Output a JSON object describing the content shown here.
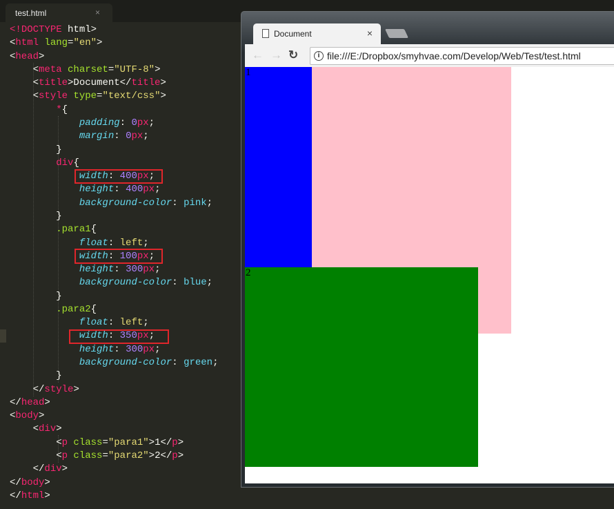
{
  "editor": {
    "tab_title": "test.html",
    "close_glyph": "×",
    "lines": [
      [
        [
          "tag",
          "<!"
        ],
        [
          "tag",
          "DOCTYPE"
        ],
        [
          "val",
          " html>"
        ]
      ],
      [
        [
          "val",
          "<"
        ],
        [
          "tag",
          "html"
        ],
        [
          "attr",
          " lang"
        ],
        [
          "val",
          "="
        ],
        [
          "str",
          "\"en\""
        ],
        [
          "val",
          ">"
        ]
      ],
      [
        [
          "val",
          "<"
        ],
        [
          "tag",
          "head"
        ],
        [
          "val",
          ">"
        ]
      ],
      [
        [
          "val",
          "    <"
        ],
        [
          "tag",
          "meta"
        ],
        [
          "attr",
          " charset"
        ],
        [
          "val",
          "="
        ],
        [
          "str",
          "\"UTF-8\""
        ],
        [
          "val",
          ">"
        ]
      ],
      [
        [
          "val",
          "    <"
        ],
        [
          "tag",
          "title"
        ],
        [
          "val",
          ">Document</"
        ],
        [
          "tag",
          "title"
        ],
        [
          "val",
          ">"
        ]
      ],
      [
        [
          "val",
          "    <"
        ],
        [
          "tag",
          "style"
        ],
        [
          "attr",
          " type"
        ],
        [
          "val",
          "="
        ],
        [
          "str",
          "\"text/css\""
        ],
        [
          "val",
          ">"
        ]
      ],
      [
        [
          "val",
          "        "
        ],
        [
          "tag",
          "*"
        ],
        [
          "val",
          "{"
        ]
      ],
      [
        [
          "val",
          "            "
        ],
        [
          "prop",
          "padding"
        ],
        [
          "val",
          ": "
        ],
        [
          "num",
          "0"
        ],
        [
          "unit",
          "px"
        ],
        [
          "val",
          ";"
        ]
      ],
      [
        [
          "val",
          "            "
        ],
        [
          "prop",
          "margin"
        ],
        [
          "val",
          ": "
        ],
        [
          "num",
          "0"
        ],
        [
          "unit",
          "px"
        ],
        [
          "val",
          ";"
        ]
      ],
      [
        [
          "val",
          "        }"
        ]
      ],
      [
        [
          "val",
          "        "
        ],
        [
          "tag",
          "div"
        ],
        [
          "val",
          "{"
        ]
      ],
      [
        [
          "val",
          "            "
        ],
        [
          "prop",
          "width"
        ],
        [
          "val",
          ": "
        ],
        [
          "num",
          "400"
        ],
        [
          "unit",
          "px"
        ],
        [
          "val",
          ";"
        ]
      ],
      [
        [
          "val",
          "            "
        ],
        [
          "prop",
          "height"
        ],
        [
          "val",
          ": "
        ],
        [
          "num",
          "400"
        ],
        [
          "unit",
          "px"
        ],
        [
          "val",
          ";"
        ]
      ],
      [
        [
          "val",
          "            "
        ],
        [
          "prop",
          "background-color"
        ],
        [
          "val",
          ": "
        ],
        [
          "kw",
          "pink"
        ],
        [
          "val",
          ";"
        ]
      ],
      [
        [
          "val",
          "        }"
        ]
      ],
      [
        [
          "val",
          "        "
        ],
        [
          "sel",
          ".para1"
        ],
        [
          "val",
          "{"
        ]
      ],
      [
        [
          "val",
          "            "
        ],
        [
          "prop",
          "float"
        ],
        [
          "val",
          ": "
        ],
        [
          "str",
          "left"
        ],
        [
          "val",
          ";"
        ]
      ],
      [
        [
          "val",
          "            "
        ],
        [
          "prop",
          "width"
        ],
        [
          "val",
          ": "
        ],
        [
          "num",
          "100"
        ],
        [
          "unit",
          "px"
        ],
        [
          "val",
          ";"
        ]
      ],
      [
        [
          "val",
          "            "
        ],
        [
          "prop",
          "height"
        ],
        [
          "val",
          ": "
        ],
        [
          "num",
          "300"
        ],
        [
          "unit",
          "px"
        ],
        [
          "val",
          ";"
        ]
      ],
      [
        [
          "val",
          "            "
        ],
        [
          "prop",
          "background-color"
        ],
        [
          "val",
          ": "
        ],
        [
          "kw",
          "blue"
        ],
        [
          "val",
          ";"
        ]
      ],
      [
        [
          "val",
          "        }"
        ]
      ],
      [
        [
          "val",
          "        "
        ],
        [
          "sel",
          ".para2"
        ],
        [
          "val",
          "{"
        ]
      ],
      [
        [
          "val",
          "            "
        ],
        [
          "prop",
          "float"
        ],
        [
          "val",
          ": "
        ],
        [
          "str",
          "left"
        ],
        [
          "val",
          ";"
        ]
      ],
      [
        [
          "val",
          "            "
        ],
        [
          "prop",
          "width"
        ],
        [
          "val",
          ": "
        ],
        [
          "num",
          "350"
        ],
        [
          "unit",
          "px"
        ],
        [
          "val",
          ";"
        ]
      ],
      [
        [
          "val",
          "            "
        ],
        [
          "prop",
          "height"
        ],
        [
          "val",
          ": "
        ],
        [
          "num",
          "300"
        ],
        [
          "unit",
          "px"
        ],
        [
          "val",
          ";"
        ]
      ],
      [
        [
          "val",
          "            "
        ],
        [
          "prop",
          "background-color"
        ],
        [
          "val",
          ": "
        ],
        [
          "kw",
          "green"
        ],
        [
          "val",
          ";"
        ]
      ],
      [
        [
          "val",
          "        }"
        ]
      ],
      [
        [
          "val",
          "    </"
        ],
        [
          "tag",
          "style"
        ],
        [
          "val",
          ">"
        ]
      ],
      [
        [
          "val",
          "</"
        ],
        [
          "tag",
          "head"
        ],
        [
          "val",
          ">"
        ]
      ],
      [
        [
          "val",
          "<"
        ],
        [
          "tag",
          "body"
        ],
        [
          "val",
          ">"
        ]
      ],
      [
        [
          "val",
          "    <"
        ],
        [
          "tag",
          "div"
        ],
        [
          "val",
          ">"
        ]
      ],
      [
        [
          "val",
          "        <"
        ],
        [
          "tag",
          "p"
        ],
        [
          "attr",
          " class"
        ],
        [
          "val",
          "="
        ],
        [
          "str",
          "\"para1\""
        ],
        [
          "val",
          ">1</"
        ],
        [
          "tag",
          "p"
        ],
        [
          "val",
          ">"
        ]
      ],
      [
        [
          "val",
          "        <"
        ],
        [
          "tag",
          "p"
        ],
        [
          "attr",
          " class"
        ],
        [
          "val",
          "="
        ],
        [
          "str",
          "\"para2\""
        ],
        [
          "val",
          ">2</"
        ],
        [
          "tag",
          "p"
        ],
        [
          "val",
          ">"
        ]
      ],
      [
        [
          "val",
          "    </"
        ],
        [
          "tag",
          "div"
        ],
        [
          "val",
          ">"
        ]
      ],
      [
        [
          "val",
          "</"
        ],
        [
          "tag",
          "body"
        ],
        [
          "val",
          ">"
        ]
      ],
      [
        [
          "val",
          "</"
        ],
        [
          "tag",
          "html"
        ],
        [
          "val",
          ">"
        ]
      ]
    ]
  },
  "browser": {
    "tab_title": "Document",
    "close_glyph": "×",
    "back_icon": "←",
    "forward_icon": "→",
    "reload_icon": "↻",
    "info_icon": "i",
    "url": "file:///E:/Dropbox/smyhvae.com/Develop/Web/Test/test.html",
    "page": {
      "para1_text": "1",
      "para2_text": "2",
      "div_color": "#ffc0cb",
      "para1_color": "#0000ff",
      "para2_color": "#008000"
    }
  }
}
